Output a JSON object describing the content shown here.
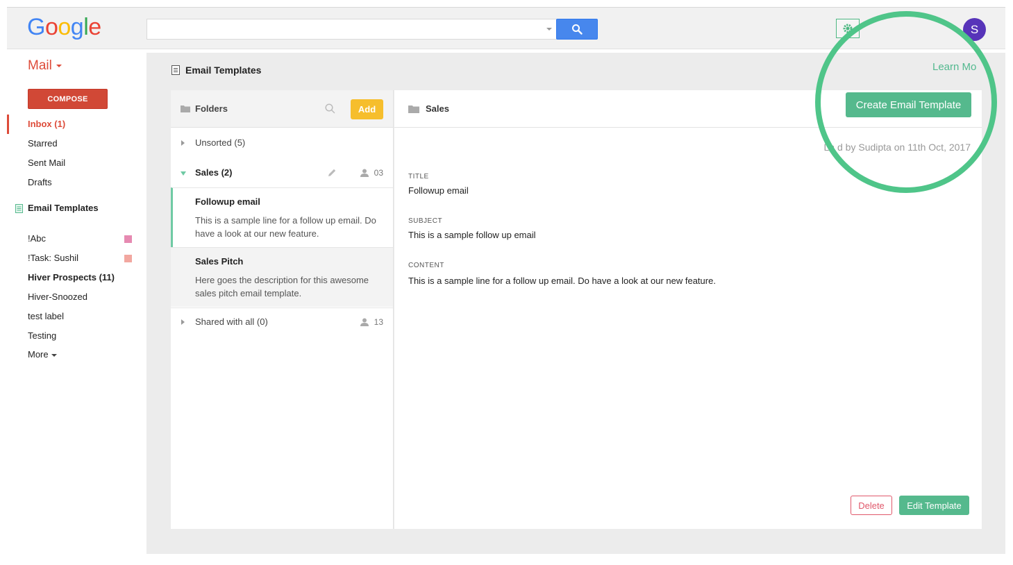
{
  "header": {
    "logo_letters": [
      {
        "ch": "G",
        "color": "#4285f4"
      },
      {
        "ch": "o",
        "color": "#ea4335"
      },
      {
        "ch": "o",
        "color": "#fbbc05"
      },
      {
        "ch": "g",
        "color": "#4285f4"
      },
      {
        "ch": "l",
        "color": "#34a853"
      },
      {
        "ch": "e",
        "color": "#ea4335"
      }
    ],
    "search_value": "",
    "avatar_initial": "S"
  },
  "sidebar": {
    "mail_label": "Mail",
    "compose_label": "COMPOSE",
    "items": [
      {
        "label": "Inbox (1)"
      },
      {
        "label": "Starred"
      },
      {
        "label": "Sent Mail"
      },
      {
        "label": "Drafts"
      }
    ],
    "email_templates_label": "Email Templates",
    "labels": [
      {
        "label": "!Abc",
        "color": "#e68ab1"
      },
      {
        "label": "!Task: Sushil",
        "color": "#f2a7a0"
      },
      {
        "label": "Hiver Prospects (11)"
      },
      {
        "label": "Hiver-Snoozed"
      },
      {
        "label": "test label"
      },
      {
        "label": "Testing"
      },
      {
        "label": "More"
      }
    ]
  },
  "main": {
    "title": "Email Templates",
    "learn_more": "Learn Mo",
    "folders": {
      "header": "Folders",
      "add_label": "Add",
      "unsorted": "Unsorted (5)",
      "sales": "Sales (2)",
      "sales_count": "03",
      "templates": [
        {
          "name": "Followup email",
          "desc": "This is a sample line for a follow up email. Do have a look at our new feature."
        },
        {
          "name": "Sales Pitch",
          "desc": "Here goes the description for this awesome sales pitch email template."
        }
      ],
      "shared": "Shared with all (0)",
      "shared_count": "13"
    },
    "detail": {
      "folder_name": "Sales",
      "create_label": "Create Email Template",
      "meta": "La    d by Sudipta on 11th Oct, 2017",
      "title_label": "TITLE",
      "title_value": "Followup email",
      "subject_label": "SUBJECT",
      "subject_value": "This is a sample follow up email",
      "content_label": "CONTENT",
      "content_value": "This is a sample line for a follow up email. Do have a look at our new feature.",
      "delete_label": "Delete",
      "edit_label": "Edit Template"
    }
  },
  "colors": {
    "accent_green": "#55b98d",
    "gmail_red": "#dd4b39",
    "add_yellow": "#f6be2c",
    "ring_green": "#4fc589"
  }
}
